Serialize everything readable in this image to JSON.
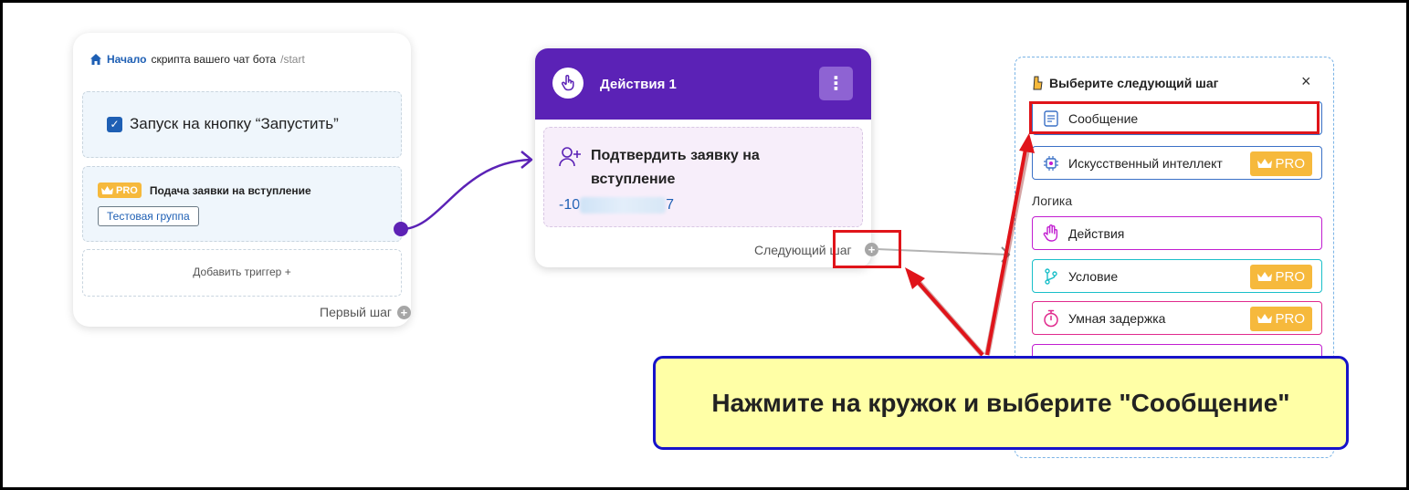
{
  "start_card": {
    "title_home": "Начало",
    "title_rest": "скрипта вашего чат бота",
    "title_cmd": "/start",
    "trigger_launch": "Запуск на кнопку “Запустить”",
    "pro_label": "PRO",
    "trigger_join": "Подача заявки на вступление",
    "group_button": "Тестовая группа",
    "add_trigger": "Добавить триггер  +",
    "first_step": "Первый шаг"
  },
  "actions_card": {
    "title": "Действия 1",
    "menu_icon": "⋮",
    "confirm_title": "Подтвердить заявку на вступление",
    "id_prefix": "-10",
    "id_suffix": "7",
    "next_step": "Следующий шаг"
  },
  "panel": {
    "title": "Выберите следующий шаг",
    "close": "×",
    "logic_label": "Логика",
    "options": [
      {
        "label": "Сообщение",
        "icon": "message-icon",
        "pro": ""
      },
      {
        "label": "Искусственный интеллект",
        "icon": "ai-chip-icon",
        "pro": "PRO"
      },
      {
        "label": "Действия",
        "icon": "hand-icon",
        "pro": ""
      },
      {
        "label": "Условие",
        "icon": "branch-icon",
        "pro": "PRO"
      },
      {
        "label": "Умная задержка",
        "icon": "timer-icon",
        "pro": "PRO"
      }
    ]
  },
  "callout": {
    "text": "Нажмите на кружок и выберите \"Сообщение\""
  },
  "colors": {
    "accent_purple": "#5b22b6",
    "link_blue": "#1e5fb4",
    "pro_orange": "#f6b93c",
    "annotation_red": "#e0141a",
    "callout_border": "#1713c9",
    "callout_fill": "#ffffa6"
  }
}
